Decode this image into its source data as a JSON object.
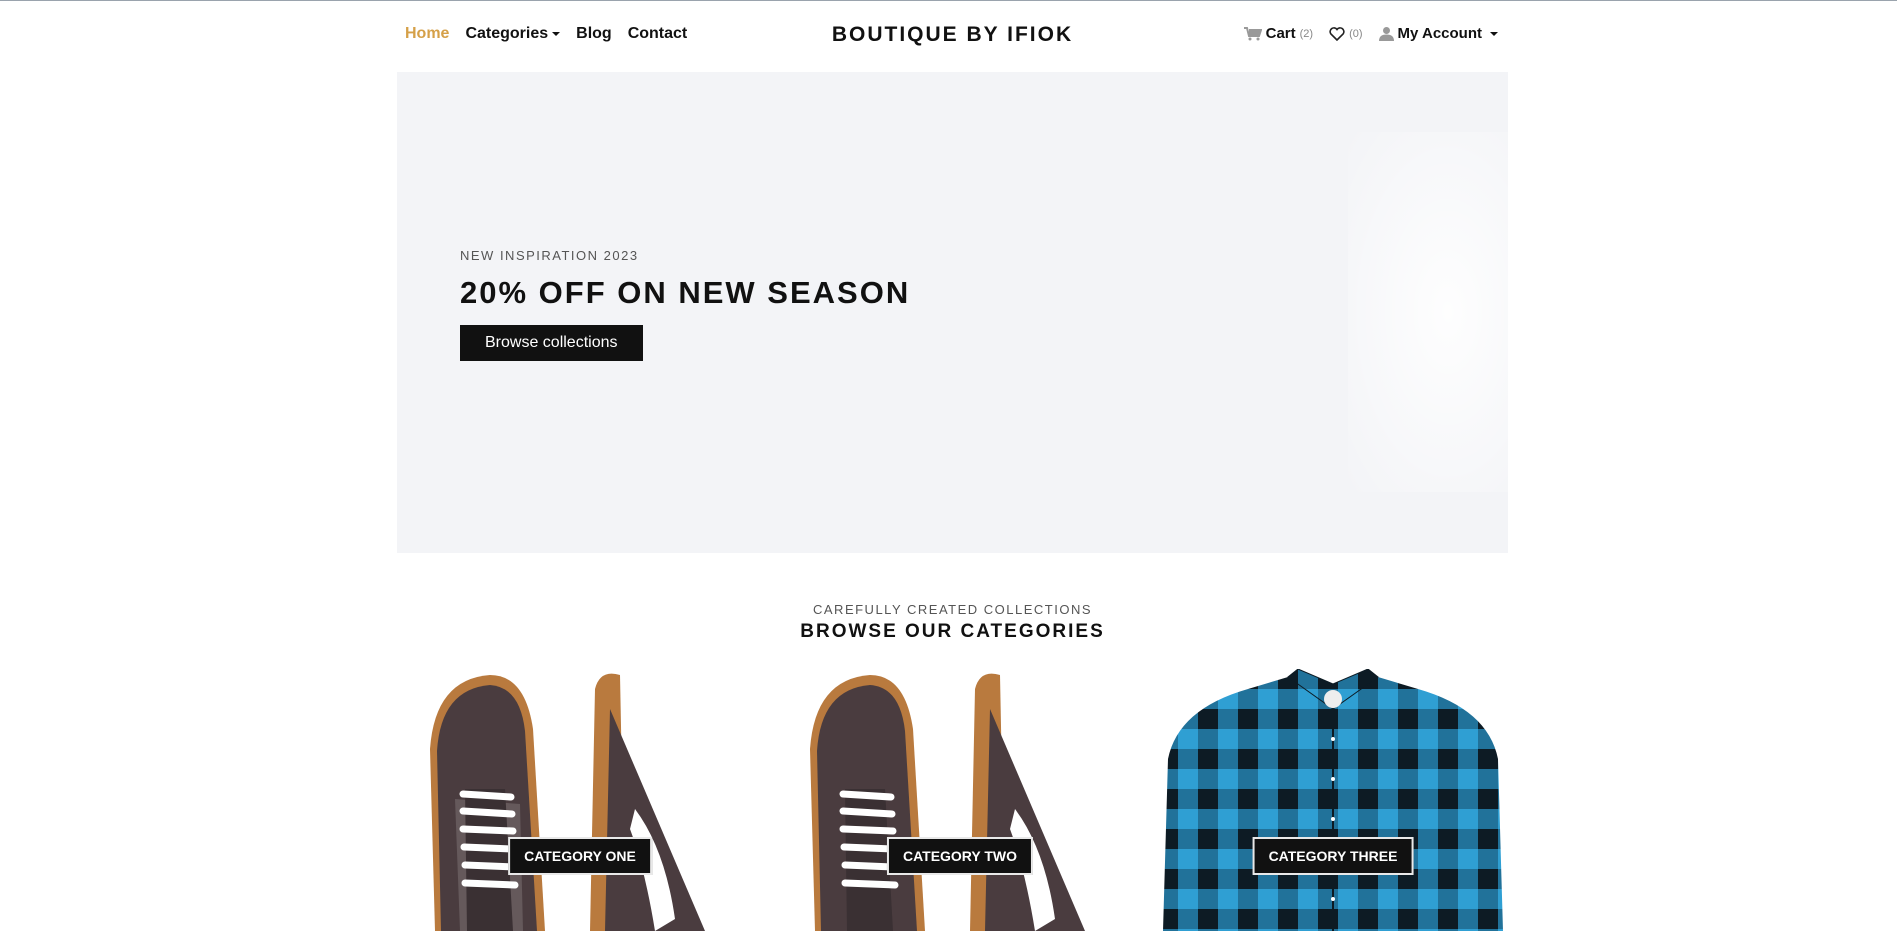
{
  "nav": {
    "home": "Home",
    "categories": "Categories",
    "blog": "Blog",
    "contact": "Contact"
  },
  "brand": "BOUTIQUE BY IFIOK",
  "header_right": {
    "cart_label": "Cart",
    "cart_count": "(2)",
    "wishlist_count": "(0)",
    "account_label": "My Account"
  },
  "hero": {
    "eyebrow": "NEW INSPIRATION 2023",
    "title": "20% OFF ON NEW SEASON",
    "button": "Browse collections"
  },
  "section": {
    "subtitle": "CAREFULLY CREATED COLLECTIONS",
    "title": "BROWSE OUR CATEGORIES"
  },
  "categories": [
    {
      "label": "CATEGORY ONE",
      "image": "sneakers"
    },
    {
      "label": "CATEGORY TWO",
      "image": "sneakers"
    },
    {
      "label": "CATEGORY THREE",
      "image": "plaid-shirt"
    }
  ],
  "colors": {
    "accent": "#d5a048",
    "dark": "#111111",
    "hero_bg": "#f3f4f7"
  }
}
